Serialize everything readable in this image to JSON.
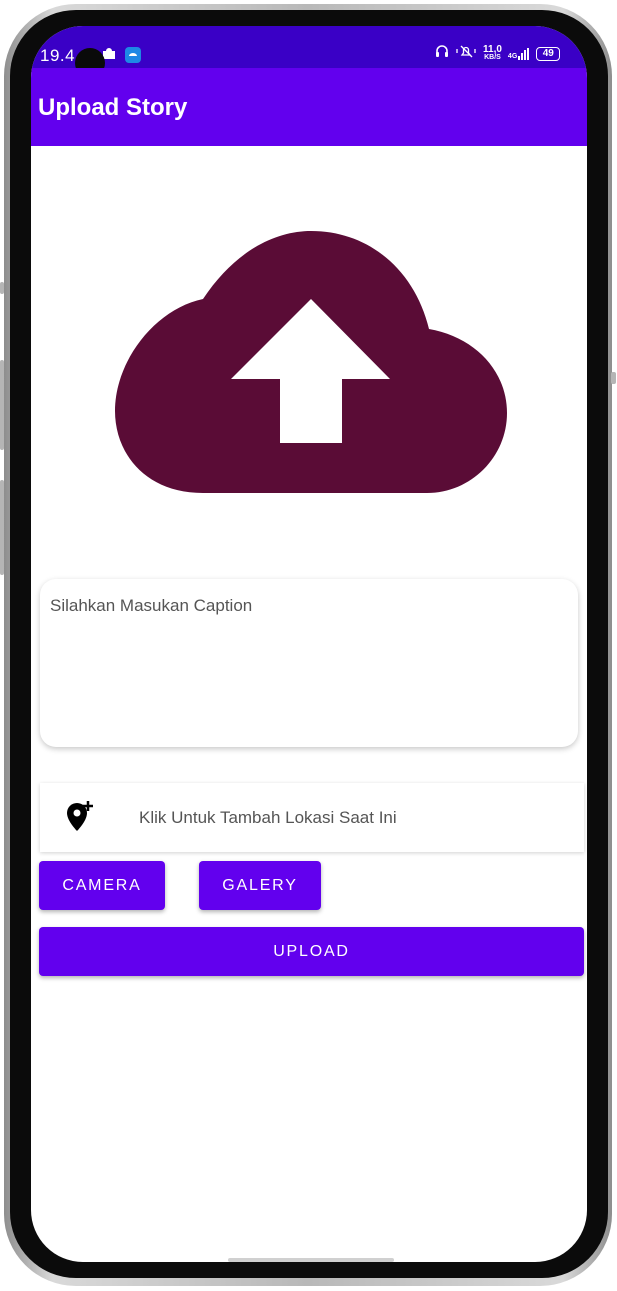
{
  "status_bar": {
    "time": "19.4",
    "network_speed_value": "11,0",
    "network_speed_unit": "KB/S",
    "network_type": "4G",
    "battery": "49",
    "icons": [
      "notification-app-icon",
      "messages-app-icon",
      "headphones-icon",
      "mute-vibrate-icon",
      "signal-icon",
      "battery-icon"
    ]
  },
  "app_bar": {
    "title": "Upload Story"
  },
  "preview": {
    "icon": "cloud-upload-icon",
    "color": "#5a0c36"
  },
  "caption": {
    "placeholder": "Silahkan Masukan Caption",
    "value": ""
  },
  "location": {
    "icon": "add-location-icon",
    "label": "Klik Untuk Tambah Lokasi Saat Ini"
  },
  "buttons": {
    "camera": "CAMERA",
    "galery": "GALERY",
    "upload": "UPLOAD"
  },
  "colors": {
    "primary": "#6200ee",
    "status_bar": "#3a00c6",
    "preview": "#5a0c36"
  }
}
